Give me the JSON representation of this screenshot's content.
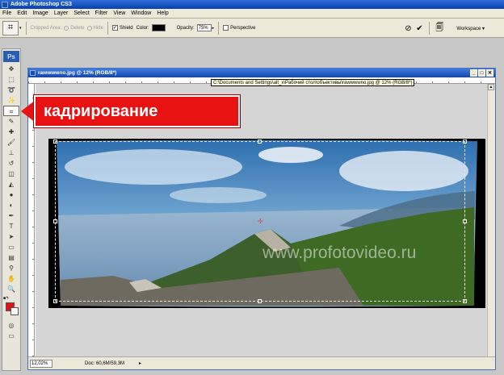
{
  "app": {
    "title": "Adobe Photoshop CS3",
    "ps_badge": "Ps"
  },
  "menu": [
    "File",
    "Edit",
    "Image",
    "Layer",
    "Select",
    "Filter",
    "View",
    "Window",
    "Help"
  ],
  "options": {
    "cropped_area_label": "Cropped Area:",
    "delete_label": "Delete",
    "hide_label": "Hide",
    "shield_label": "Shield",
    "color_label": "Color:",
    "opacity_label": "Opacity:",
    "opacity_value": "75%",
    "perspective_label": "Perspective",
    "shield_checked": true,
    "perspective_checked": false,
    "shield_color": "#000000",
    "workspace_label": "Workspace"
  },
  "document": {
    "title": "rawwwwno.jpg @ 12% (RGB/8*)",
    "tooltip": "C:\\Documents and Settings\\alt_x\\Рабочий стол\\объективы\\rawwwwno.jpg @ 12% (RGB/8*)",
    "zoom": "12,02%",
    "doc_info": "Doc: 60,6M/59,3M",
    "watermark": "www.profotovideo.ru"
  },
  "annotation": {
    "text": "кадрирование",
    "color": "#e81212"
  },
  "tools": [
    {
      "name": "move-tool",
      "glyph": "✥"
    },
    {
      "name": "marquee-tool",
      "glyph": "⬚"
    },
    {
      "name": "lasso-tool",
      "glyph": "➰"
    },
    {
      "name": "magic-wand-tool",
      "glyph": "✨"
    },
    {
      "name": "crop-tool",
      "glyph": "⌗",
      "active": true
    },
    {
      "name": "slice-tool",
      "glyph": "✎"
    },
    {
      "name": "healing-brush-tool",
      "glyph": "✚"
    },
    {
      "name": "brush-tool",
      "glyph": "🖌"
    },
    {
      "name": "clone-stamp-tool",
      "glyph": "⊥"
    },
    {
      "name": "history-brush-tool",
      "glyph": "↺"
    },
    {
      "name": "eraser-tool",
      "glyph": "◫"
    },
    {
      "name": "paint-bucket-tool",
      "glyph": "◭"
    },
    {
      "name": "blur-tool",
      "glyph": "●"
    },
    {
      "name": "dodge-tool",
      "glyph": "◐"
    },
    {
      "name": "pen-tool",
      "glyph": "✒"
    },
    {
      "name": "type-tool",
      "glyph": "T"
    },
    {
      "name": "path-selection-tool",
      "glyph": "➤"
    },
    {
      "name": "shape-tool",
      "glyph": "▭"
    },
    {
      "name": "notes-tool",
      "glyph": "▤"
    },
    {
      "name": "eyedropper-tool",
      "glyph": "⚲"
    },
    {
      "name": "hand-tool",
      "glyph": "✋"
    },
    {
      "name": "zoom-tool",
      "glyph": "🔍"
    }
  ],
  "colors": {
    "foreground": "#e81010",
    "background": "#ffffff"
  }
}
